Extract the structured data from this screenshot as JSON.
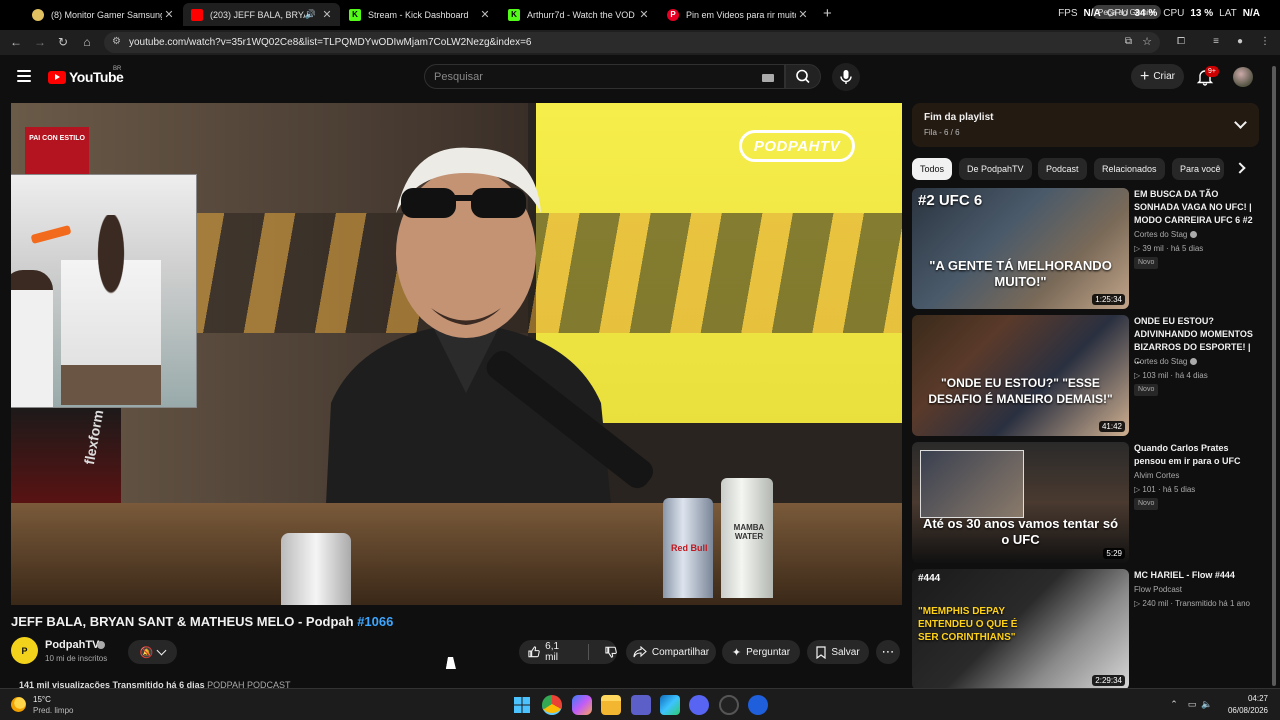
{
  "browser": {
    "tabs": [
      {
        "title": "(8) Monitor Gamer Samsung Od",
        "favicon_color": "#e0c060"
      },
      {
        "title": "(203) JEFF BALA, BRYAN SA",
        "favicon_color": "#ff0000"
      },
      {
        "title": "Stream - Kick Dashboard",
        "favicon_color": "#53fc18"
      },
      {
        "title": "Arthurr7d - Watch the VOD on",
        "favicon_color": "#53fc18"
      },
      {
        "title": "Pin em Videos para rir muito",
        "favicon_color": "#e60023"
      }
    ],
    "url": "youtube.com/watch?v=35r1WQ02Ce8&list=TLPQMDYwODIwMjam7CoLW2Nezg&index=6",
    "gemini_label": "Peça ao Gemini",
    "overlay": {
      "fps_label": "FPS",
      "fps_value": "N/A",
      "gpu_label": "GPU",
      "gpu_value": "34 %",
      "cpu_label": "CPU",
      "cpu_value": "13 %",
      "lat_label": "LAT",
      "lat_value": "N/A"
    }
  },
  "header": {
    "logo_text": "YouTube",
    "country": "BR",
    "search_placeholder": "Pesquisar",
    "create_label": "Criar",
    "notif_count": "9+"
  },
  "player": {
    "overlay_logo": "PODPAHTV",
    "stream_logo": "PAI CON ESTILO",
    "can1_label": "Red Bull",
    "can2_label": "MAMBA WATER",
    "set_label": "flexform"
  },
  "video": {
    "title": "JEFF BALA, BRYAN SANT & MATHEUS MELO - Podpah",
    "title_tag": "#1066",
    "channel": "PodpahTV",
    "subscribers": "10 mi de inscritos",
    "likes": "6,1 mil",
    "share_label": "Compartilhar",
    "ask_label": "Perguntar",
    "save_label": "Salvar",
    "views_line": "141 mil visualizações  Transmitido há 6 dias",
    "views_channel": "PODPAH PODCAST"
  },
  "playlist": {
    "title": "Fim da playlist",
    "subtitle": "Fila - 6 / 6"
  },
  "chips": [
    "Todos",
    "De PodpahTV",
    "Podcast",
    "Relacionados",
    "Para você"
  ],
  "recommendations": [
    {
      "title": "EM BUSCA DA TÃO SONHADA VAGA NO UFC! | MODO CARREIRA UFC 6 #2",
      "channel": "Cortes do Stag",
      "meta": "39 mil · há 5 dias",
      "badge": "Novo",
      "duration": "1:25:34",
      "thumb_caption": "\"A GENTE TÁ MELHORANDO MUITO!\"",
      "thumb_top": "#2 UFC 6"
    },
    {
      "title": "ONDE EU ESTOU? ADIVINHANDO MOMENTOS BIZARROS DO ESPORTE! | ...",
      "channel": "Cortes do Stag",
      "meta": "103 mil · há 4 dias",
      "badge": "Novo",
      "duration": "41:42",
      "thumb_caption": "\"ONDE EU ESTOU?\" \"ESSE DESAFIO É MANEIRO DEMAIS!\"",
      "thumb_top": ""
    },
    {
      "title": "Quando Carlos Prates pensou em ir para o UFC",
      "channel": "Alvim Cortes",
      "meta": "101 · há 5 dias",
      "badge": "Novo",
      "duration": "5:29",
      "thumb_caption": "Até os 30 anos vamos tentar só o UFC",
      "thumb_top": ""
    },
    {
      "title": "MC HARIEL - Flow #444",
      "channel": "Flow Podcast",
      "meta": "240 mil · Transmitido há 1 ano",
      "badge": "",
      "duration": "2:29:34",
      "thumb_caption": "\"MEMPHIS DEPAY ENTENDEU O QUE É SER CORINTHIANS\"",
      "thumb_top": "#444"
    }
  ],
  "taskbar": {
    "temp": "15°C",
    "weather": "Pred. limpo",
    "time": "04:27",
    "date": "06/08/2026"
  }
}
